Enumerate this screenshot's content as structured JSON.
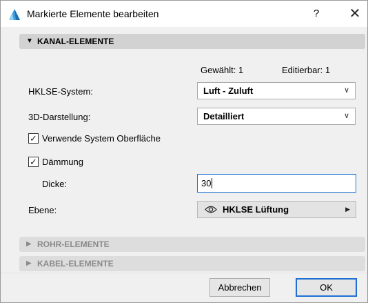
{
  "window": {
    "title": "Markierte Elemente bearbeiten",
    "help_label": "?",
    "close_label": "✕"
  },
  "sections": {
    "kanal": {
      "label": "KANAL-ELEMENTE",
      "expanded": true
    },
    "rohr": {
      "label": "ROHR-ELEMENTE",
      "expanded": false
    },
    "kabel": {
      "label": "KABEL-ELEMENTE",
      "expanded": false
    }
  },
  "counts": {
    "gewaehlt": "Gewählt: 1",
    "editierbar": "Editierbar: 1"
  },
  "fields": {
    "hklse_label": "HKLSE-System:",
    "hklse_value": "Luft - Zuluft",
    "darstellung_label": "3D-Darstellung:",
    "darstellung_value": "Detailliert",
    "oberflaeche_label": "Verwende System Oberfläche",
    "oberflaeche_checked": true,
    "daemmung_label": "Dämmung",
    "daemmung_checked": true,
    "dicke_label": "Dicke:",
    "dicke_value": "30",
    "ebene_label": "Ebene:",
    "ebene_value": "HKLSE Lüftung"
  },
  "buttons": {
    "cancel": "Abbrechen",
    "ok": "OK"
  },
  "icons": {
    "app": "archicad-app-icon",
    "layer_visibility": "eye-icon",
    "dropdown": "chevron-down-icon",
    "submenu": "triangle-right-icon"
  },
  "colors": {
    "accent": "#1e6fd1",
    "section_bg": "#d2d2d2",
    "dialog_bg": "#f0f0f0"
  }
}
